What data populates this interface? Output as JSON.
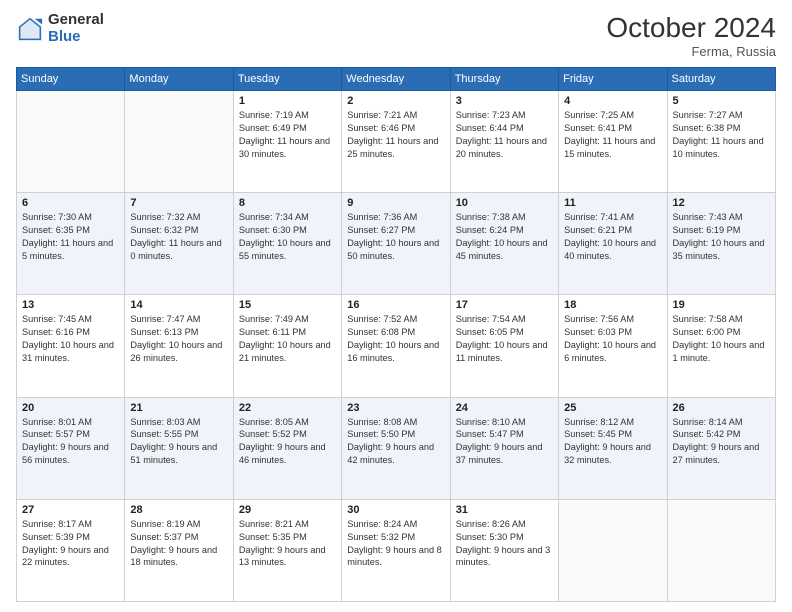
{
  "logo": {
    "general": "General",
    "blue": "Blue"
  },
  "header": {
    "month": "October 2024",
    "location": "Ferma, Russia"
  },
  "weekdays": [
    "Sunday",
    "Monday",
    "Tuesday",
    "Wednesday",
    "Thursday",
    "Friday",
    "Saturday"
  ],
  "weeks": [
    [
      {
        "day": "",
        "info": ""
      },
      {
        "day": "",
        "info": ""
      },
      {
        "day": "1",
        "info": "Sunrise: 7:19 AM\nSunset: 6:49 PM\nDaylight: 11 hours and 30 minutes."
      },
      {
        "day": "2",
        "info": "Sunrise: 7:21 AM\nSunset: 6:46 PM\nDaylight: 11 hours and 25 minutes."
      },
      {
        "day": "3",
        "info": "Sunrise: 7:23 AM\nSunset: 6:44 PM\nDaylight: 11 hours and 20 minutes."
      },
      {
        "day": "4",
        "info": "Sunrise: 7:25 AM\nSunset: 6:41 PM\nDaylight: 11 hours and 15 minutes."
      },
      {
        "day": "5",
        "info": "Sunrise: 7:27 AM\nSunset: 6:38 PM\nDaylight: 11 hours and 10 minutes."
      }
    ],
    [
      {
        "day": "6",
        "info": "Sunrise: 7:30 AM\nSunset: 6:35 PM\nDaylight: 11 hours and 5 minutes."
      },
      {
        "day": "7",
        "info": "Sunrise: 7:32 AM\nSunset: 6:32 PM\nDaylight: 11 hours and 0 minutes."
      },
      {
        "day": "8",
        "info": "Sunrise: 7:34 AM\nSunset: 6:30 PM\nDaylight: 10 hours and 55 minutes."
      },
      {
        "day": "9",
        "info": "Sunrise: 7:36 AM\nSunset: 6:27 PM\nDaylight: 10 hours and 50 minutes."
      },
      {
        "day": "10",
        "info": "Sunrise: 7:38 AM\nSunset: 6:24 PM\nDaylight: 10 hours and 45 minutes."
      },
      {
        "day": "11",
        "info": "Sunrise: 7:41 AM\nSunset: 6:21 PM\nDaylight: 10 hours and 40 minutes."
      },
      {
        "day": "12",
        "info": "Sunrise: 7:43 AM\nSunset: 6:19 PM\nDaylight: 10 hours and 35 minutes."
      }
    ],
    [
      {
        "day": "13",
        "info": "Sunrise: 7:45 AM\nSunset: 6:16 PM\nDaylight: 10 hours and 31 minutes."
      },
      {
        "day": "14",
        "info": "Sunrise: 7:47 AM\nSunset: 6:13 PM\nDaylight: 10 hours and 26 minutes."
      },
      {
        "day": "15",
        "info": "Sunrise: 7:49 AM\nSunset: 6:11 PM\nDaylight: 10 hours and 21 minutes."
      },
      {
        "day": "16",
        "info": "Sunrise: 7:52 AM\nSunset: 6:08 PM\nDaylight: 10 hours and 16 minutes."
      },
      {
        "day": "17",
        "info": "Sunrise: 7:54 AM\nSunset: 6:05 PM\nDaylight: 10 hours and 11 minutes."
      },
      {
        "day": "18",
        "info": "Sunrise: 7:56 AM\nSunset: 6:03 PM\nDaylight: 10 hours and 6 minutes."
      },
      {
        "day": "19",
        "info": "Sunrise: 7:58 AM\nSunset: 6:00 PM\nDaylight: 10 hours and 1 minute."
      }
    ],
    [
      {
        "day": "20",
        "info": "Sunrise: 8:01 AM\nSunset: 5:57 PM\nDaylight: 9 hours and 56 minutes."
      },
      {
        "day": "21",
        "info": "Sunrise: 8:03 AM\nSunset: 5:55 PM\nDaylight: 9 hours and 51 minutes."
      },
      {
        "day": "22",
        "info": "Sunrise: 8:05 AM\nSunset: 5:52 PM\nDaylight: 9 hours and 46 minutes."
      },
      {
        "day": "23",
        "info": "Sunrise: 8:08 AM\nSunset: 5:50 PM\nDaylight: 9 hours and 42 minutes."
      },
      {
        "day": "24",
        "info": "Sunrise: 8:10 AM\nSunset: 5:47 PM\nDaylight: 9 hours and 37 minutes."
      },
      {
        "day": "25",
        "info": "Sunrise: 8:12 AM\nSunset: 5:45 PM\nDaylight: 9 hours and 32 minutes."
      },
      {
        "day": "26",
        "info": "Sunrise: 8:14 AM\nSunset: 5:42 PM\nDaylight: 9 hours and 27 minutes."
      }
    ],
    [
      {
        "day": "27",
        "info": "Sunrise: 8:17 AM\nSunset: 5:39 PM\nDaylight: 9 hours and 22 minutes."
      },
      {
        "day": "28",
        "info": "Sunrise: 8:19 AM\nSunset: 5:37 PM\nDaylight: 9 hours and 18 minutes."
      },
      {
        "day": "29",
        "info": "Sunrise: 8:21 AM\nSunset: 5:35 PM\nDaylight: 9 hours and 13 minutes."
      },
      {
        "day": "30",
        "info": "Sunrise: 8:24 AM\nSunset: 5:32 PM\nDaylight: 9 hours and 8 minutes."
      },
      {
        "day": "31",
        "info": "Sunrise: 8:26 AM\nSunset: 5:30 PM\nDaylight: 9 hours and 3 minutes."
      },
      {
        "day": "",
        "info": ""
      },
      {
        "day": "",
        "info": ""
      }
    ]
  ]
}
